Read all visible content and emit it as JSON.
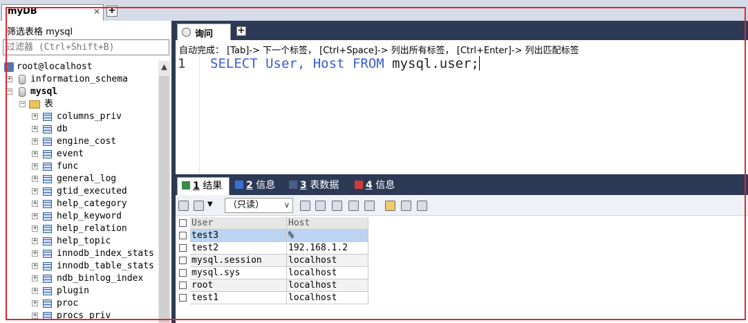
{
  "connection_tab": {
    "label": "myDB",
    "close": "✕",
    "add": "+"
  },
  "filter": {
    "label": "筛选表格 mysql",
    "placeholder": "过滤器 (Ctrl+Shift+B)"
  },
  "tree": {
    "root": "root@localhost",
    "databases": [
      {
        "name": "information_schema",
        "expanded": false
      },
      {
        "name": "mysql",
        "expanded": true
      }
    ],
    "folder": "表",
    "tables": [
      "columns_priv",
      "db",
      "engine_cost",
      "event",
      "func",
      "general_log",
      "gtid_executed",
      "help_category",
      "help_keyword",
      "help_relation",
      "help_topic",
      "innodb_index_stats",
      "innodb_table_stats",
      "ndb_binlog_index",
      "plugin",
      "proc",
      "procs_priv"
    ]
  },
  "query_tab": {
    "label": "询问",
    "add": "+"
  },
  "autocomplete_hint": "自动完成： [Tab]-> 下一个标签， [Ctrl+Space]-> 列出所有标签， [Ctrl+Enter]-> 列出匹配标签",
  "editor": {
    "line_number": "1",
    "tokens": [
      {
        "text": "SELECT ",
        "kind": "kw"
      },
      {
        "text": "User",
        "kind": "kw"
      },
      {
        "text": ", ",
        "kind": "kw"
      },
      {
        "text": "Host ",
        "kind": "kw"
      },
      {
        "text": "FROM ",
        "kind": "kw"
      },
      {
        "text": "mysql.user;",
        "kind": "plain"
      }
    ]
  },
  "result_tabs": [
    {
      "num": "1",
      "label": "结果",
      "active": true,
      "icon": "grid-icon"
    },
    {
      "num": "2",
      "label": "信息",
      "active": false,
      "icon": "info-icon"
    },
    {
      "num": "3",
      "label": "表数据",
      "active": false,
      "icon": "table-data-icon"
    },
    {
      "num": "4",
      "label": "信息",
      "active": false,
      "icon": "info-icon"
    }
  ],
  "toolbar": {
    "mode": "（只读）"
  },
  "grid": {
    "columns": [
      "User",
      "Host"
    ],
    "rows": [
      [
        "test3",
        "%"
      ],
      [
        "test2",
        "192.168.1.2"
      ],
      [
        "mysql.session",
        "localhost"
      ],
      [
        "mysql.sys",
        "localhost"
      ],
      [
        "root",
        "localhost"
      ],
      [
        "test1",
        "localhost"
      ]
    ]
  },
  "colors": {
    "accent_dark": "#2c3a55",
    "keyword": "#3b5bcf",
    "highlight_box": "#e6232b"
  }
}
